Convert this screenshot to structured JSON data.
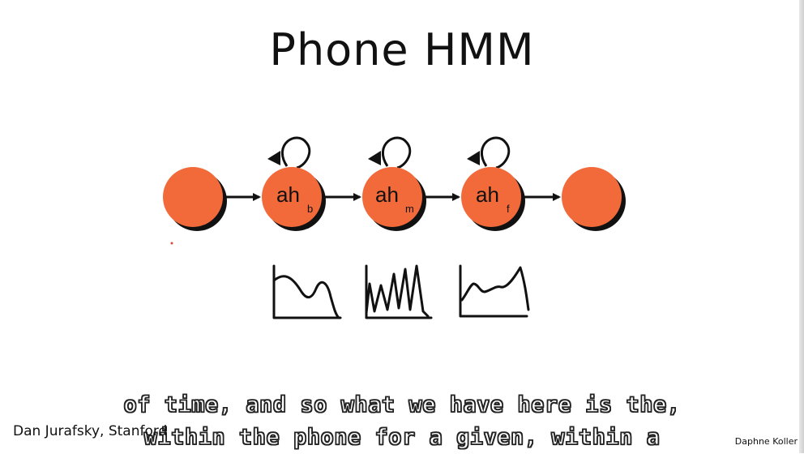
{
  "slide": {
    "title": "Phone HMM"
  },
  "states": [
    {
      "label": "",
      "sub": ""
    },
    {
      "label": "ah",
      "sub": "b"
    },
    {
      "label": "ah",
      "sub": "m"
    },
    {
      "label": "ah",
      "sub": "f"
    },
    {
      "label": "",
      "sub": ""
    }
  ],
  "colors": {
    "state_fill": "#f26a3a",
    "state_shadow": "#111111",
    "ink": "#111111"
  },
  "credits": {
    "left": "Dan Jurafsky, Stanford",
    "right": "Daphne Koller"
  },
  "subtitles": {
    "line1": "of time, and so what we have here is the,",
    "line2": "within the phone for a given, within a"
  }
}
